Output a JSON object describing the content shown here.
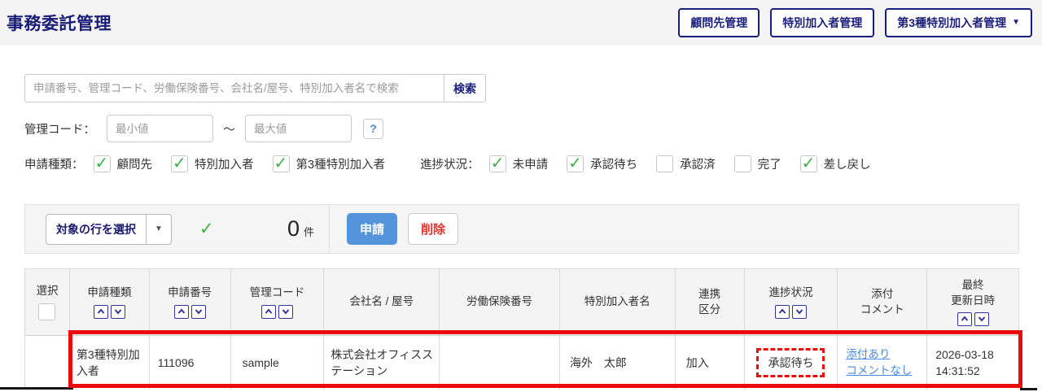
{
  "page": {
    "title": "事務委託管理"
  },
  "header_buttons": [
    {
      "label": "顧問先管理"
    },
    {
      "label": "特別加入者管理"
    },
    {
      "label": "第3種特別加入者管理",
      "has_dropdown": true
    }
  ],
  "search": {
    "placeholder": "申請番号、管理コード、労働保険番号、会社名/屋号、特別加入者名で検索",
    "button_label": "検索"
  },
  "code_range": {
    "label": "管理コード：",
    "min_placeholder": "最小値",
    "separator": "～",
    "max_placeholder": "最大値",
    "help_label": "?"
  },
  "filters": {
    "type": {
      "label": "申請種類：",
      "options": [
        {
          "label": "顧問先",
          "checked": true
        },
        {
          "label": "特別加入者",
          "checked": true
        },
        {
          "label": "第3種特別加入者",
          "checked": true
        }
      ]
    },
    "status": {
      "label": "進捗状況：",
      "options": [
        {
          "label": "未申請",
          "checked": true
        },
        {
          "label": "承認待ち",
          "checked": true
        },
        {
          "label": "承認済",
          "checked": false
        },
        {
          "label": "完了",
          "checked": false
        },
        {
          "label": "差し戻し",
          "checked": true
        }
      ]
    }
  },
  "action_bar": {
    "row_select_label": "対象の行を選択",
    "selected_count": "0",
    "count_unit": "件",
    "apply_label": "申請",
    "delete_label": "削除"
  },
  "table": {
    "select_all_checked": false,
    "headers": [
      {
        "label": "選択",
        "sortable": false
      },
      {
        "label": "申請種類",
        "sortable": true
      },
      {
        "label": "申請番号",
        "sortable": true
      },
      {
        "label": "管理コード",
        "sortable": true
      },
      {
        "label": "会社名 / 屋号",
        "sortable": false
      },
      {
        "label": "労働保険番号",
        "sortable": false
      },
      {
        "label": "特別加入者名",
        "sortable": false
      },
      {
        "label": "連携\n区分",
        "sortable": false
      },
      {
        "label": "進捗状況",
        "sortable": true
      },
      {
        "label": "添付\nコメント",
        "sortable": false
      },
      {
        "label": "最終\n更新日時",
        "sortable": true
      }
    ],
    "row": {
      "selected": false,
      "type": "第3種特別加入者",
      "application_no": "111096",
      "management_code": "sample",
      "company": "株式会社オフィスステーション",
      "insurance_no": "",
      "member_name": "海外　太郎",
      "link_type": "加入",
      "status": "承認待ち",
      "attachment_link": "添付あり",
      "comment_link": "コメントなし",
      "updated_date": "2026-03-18",
      "updated_time": "14:31:52"
    }
  },
  "colors": {
    "navy": "#1a1d7a",
    "primary_blue": "#5494dd",
    "danger_red": "#e5322d",
    "link_blue": "#4a89dc",
    "check_green": "#3faf4b",
    "highlight_red": "#ea0b0b"
  }
}
